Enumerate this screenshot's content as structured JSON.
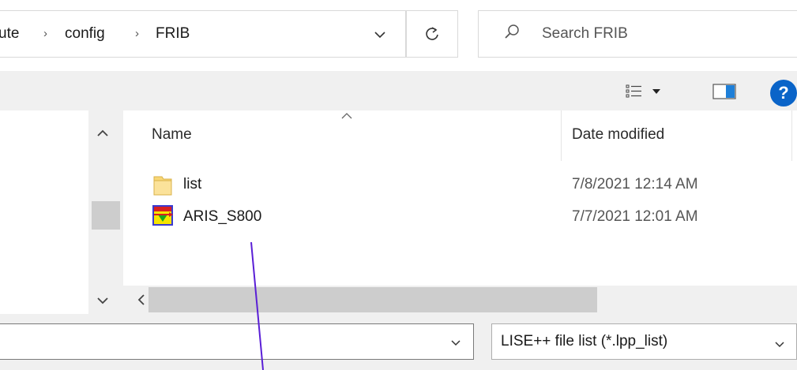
{
  "address_bar": {
    "crumbs": [
      "ute",
      "config",
      "FRIB"
    ],
    "separator": "›"
  },
  "search": {
    "placeholder": "Search FRIB"
  },
  "toolbar": {
    "help_label": "?"
  },
  "list": {
    "columns": [
      "Name",
      "Date modified"
    ],
    "rows": [
      {
        "name": "list",
        "date": "7/8/2021 12:14 AM",
        "kind": "folder"
      },
      {
        "name": "ARIS_S800",
        "date": "7/7/2021 12:01 AM",
        "kind": "lise-file"
      }
    ]
  },
  "file_type_filter": {
    "selected": "LISE++ file list (*.lpp_list)"
  },
  "file_name": {
    "value": ""
  },
  "colors": {
    "accent_help": "#0a64c8",
    "toolbar_bg": "#f0f0f0",
    "annotation_line": "#5a1fd6",
    "folder_yellow": "#f8d775"
  },
  "icons": [
    "chevron-down-icon",
    "refresh-icon",
    "search-icon",
    "view-options-icon",
    "preview-pane-icon",
    "help-icon",
    "folder-icon",
    "lise-file-icon",
    "scroll-up-icon",
    "scroll-down-icon",
    "scroll-left-icon"
  ]
}
